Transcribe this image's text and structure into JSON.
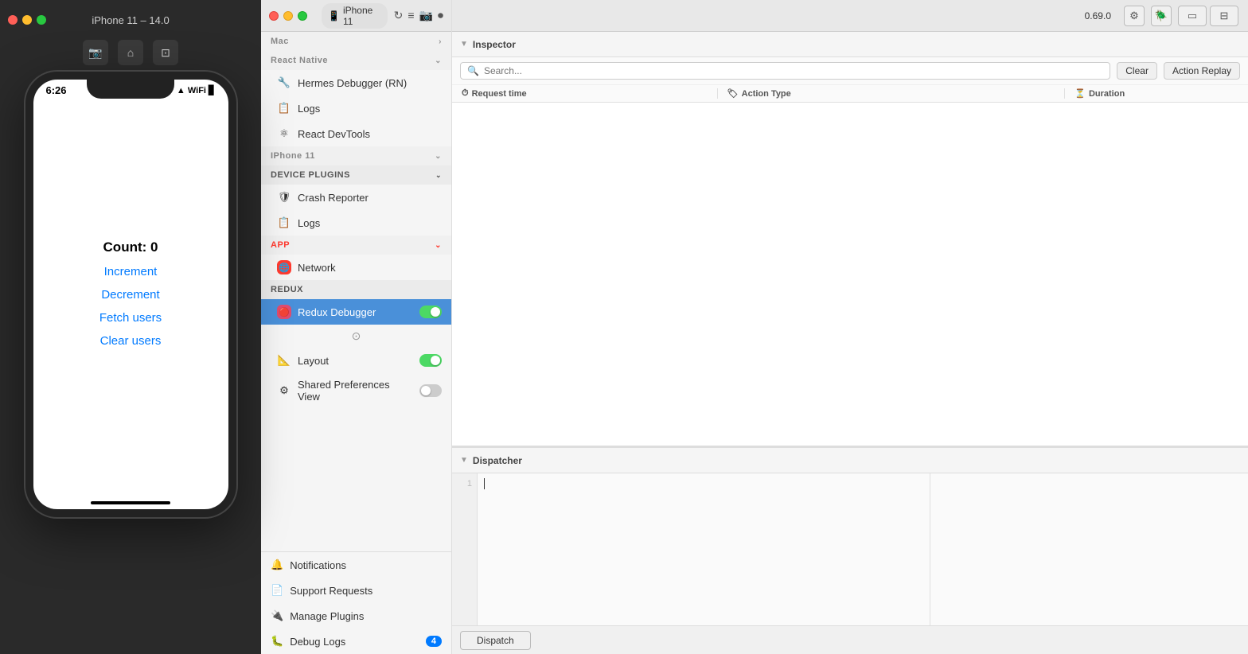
{
  "simulator": {
    "title": "iPhone 11 – 14.0",
    "status_time": "6:26",
    "status_icons": "▲ WiFi 🔋",
    "count_label": "Count: 0",
    "actions": [
      {
        "label": "Increment"
      },
      {
        "label": "Decrement"
      },
      {
        "label": "Fetch users"
      },
      {
        "label": "Clear users"
      }
    ]
  },
  "topbar": {
    "iphone_label": "iPhone 11",
    "version": "0.69.0"
  },
  "sidebar": {
    "mac_label": "Mac",
    "react_native_label": "React Native",
    "react_native_items": [
      {
        "icon": "🔧",
        "label": "Hermes Debugger (RN)"
      },
      {
        "icon": "📋",
        "label": "Logs"
      },
      {
        "icon": "⚛",
        "label": "React DevTools"
      }
    ],
    "iphone_label": "IPhone 11",
    "device_plugins_label": "DEVICE PLUGINS",
    "device_items": [
      {
        "icon": "🛡",
        "label": "Crash Reporter"
      },
      {
        "icon": "📋",
        "label": "Logs"
      }
    ],
    "app_label": "APP",
    "app_items": [
      {
        "icon": "🌐",
        "label": "Network",
        "active": false
      }
    ],
    "redux_label": "REDUX",
    "redux_items": [
      {
        "icon": "🔴",
        "label": "Redux Debugger",
        "active": true,
        "toggle": true,
        "toggle_on": true
      }
    ],
    "extra_items": [
      {
        "icon": "📐",
        "label": "Layout",
        "toggle": true,
        "toggle_on": true
      },
      {
        "icon": "⚙",
        "label": "Shared Preferences View",
        "toggle": true,
        "toggle_on": false
      }
    ],
    "bottom_items": [
      {
        "icon": "🔔",
        "label": "Notifications"
      },
      {
        "icon": "📄",
        "label": "Support Requests"
      },
      {
        "icon": "🔌",
        "label": "Manage Plugins"
      },
      {
        "icon": "🐛",
        "label": "Debug Logs",
        "badge": "4"
      }
    ]
  },
  "inspector": {
    "title": "Inspector",
    "search_placeholder": "Search...",
    "clear_label": "Clear",
    "action_replay_label": "Action Replay",
    "columns": [
      {
        "icon": "⏱",
        "label": "Request time"
      },
      {
        "icon": "🏷",
        "label": "Action Type"
      },
      {
        "icon": "⏳",
        "label": "Duration"
      }
    ]
  },
  "dispatcher": {
    "title": "Dispatcher",
    "dispatch_label": "Dispatch"
  }
}
